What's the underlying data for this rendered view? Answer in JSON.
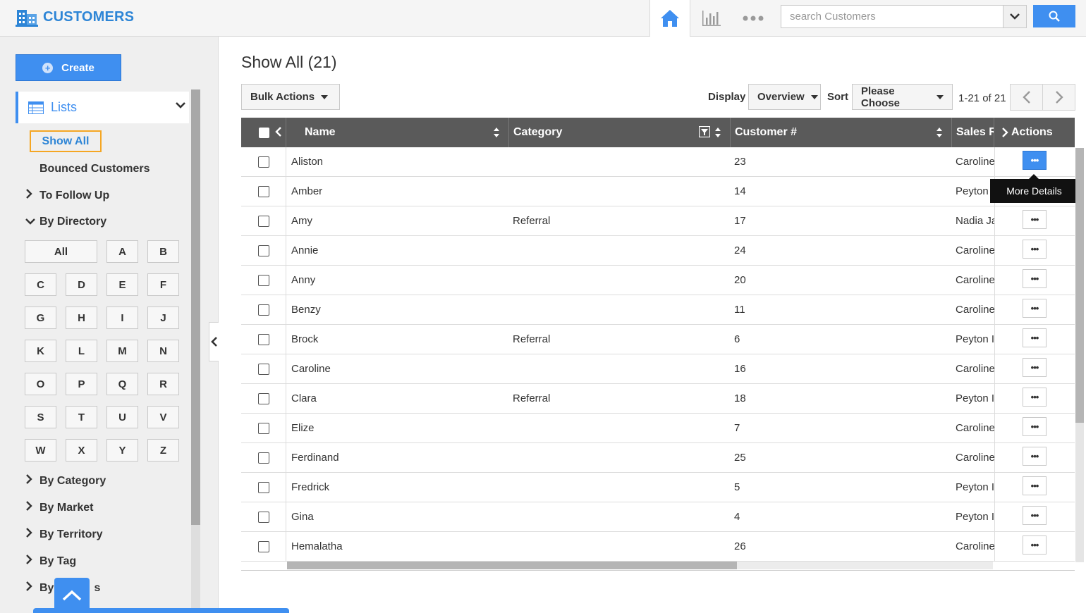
{
  "app": {
    "title": "CUSTOMERS"
  },
  "search": {
    "placeholder": "search Customers"
  },
  "sidebar": {
    "create_label": "Create",
    "lists_label": "Lists",
    "show_all": "Show All",
    "bounced": "Bounced Customers",
    "to_follow_up": "To Follow Up",
    "by_directory": "By Directory",
    "letters": [
      "All",
      "A",
      "B",
      "C",
      "D",
      "E",
      "F",
      "G",
      "H",
      "I",
      "J",
      "K",
      "L",
      "M",
      "N",
      "O",
      "P",
      "Q",
      "R",
      "S",
      "T",
      "U",
      "V",
      "W",
      "X",
      "Y",
      "Z"
    ],
    "by_category": "By Category",
    "by_market": "By Market",
    "by_territory": "By Territory",
    "by_tag": "By Tag",
    "by_partial": "By",
    "by_partial_end": "s"
  },
  "main": {
    "title": "Show All (21)",
    "bulk_actions": "Bulk Actions",
    "display_label": "Display",
    "display_value": "Overview",
    "sort_label": "Sort",
    "sort_value": "Please Choose",
    "pager": "1-21 of 21",
    "columns": {
      "name": "Name",
      "category": "Category",
      "customer_no": "Customer #",
      "sales": "Sales R",
      "actions": "Actions"
    },
    "tooltip": "More Details",
    "rows": [
      {
        "name": "Aliston",
        "category": "",
        "customer_no": "23",
        "sales": "Caroline"
      },
      {
        "name": "Amber",
        "category": "",
        "customer_no": "14",
        "sales": "Peyton"
      },
      {
        "name": "Amy",
        "category": "Referral",
        "customer_no": "17",
        "sales": "Nadia Ja"
      },
      {
        "name": "Annie",
        "category": "",
        "customer_no": "24",
        "sales": "Caroline"
      },
      {
        "name": "Anny",
        "category": "",
        "customer_no": "20",
        "sales": "Caroline"
      },
      {
        "name": "Benzy",
        "category": "",
        "customer_no": "11",
        "sales": "Caroline"
      },
      {
        "name": "Brock",
        "category": "Referral",
        "customer_no": "6",
        "sales": "Peyton I"
      },
      {
        "name": "Caroline",
        "category": "",
        "customer_no": "16",
        "sales": "Caroline"
      },
      {
        "name": "Clara",
        "category": "Referral",
        "customer_no": "18",
        "sales": "Peyton I"
      },
      {
        "name": "Elize",
        "category": "",
        "customer_no": "7",
        "sales": "Caroline"
      },
      {
        "name": "Ferdinand",
        "category": "",
        "customer_no": "25",
        "sales": "Caroline"
      },
      {
        "name": "Fredrick",
        "category": "",
        "customer_no": "5",
        "sales": "Peyton I"
      },
      {
        "name": "Gina",
        "category": "",
        "customer_no": "4",
        "sales": "Peyton I"
      },
      {
        "name": "Hemalatha",
        "category": "",
        "customer_no": "26",
        "sales": "Caroline"
      }
    ]
  }
}
